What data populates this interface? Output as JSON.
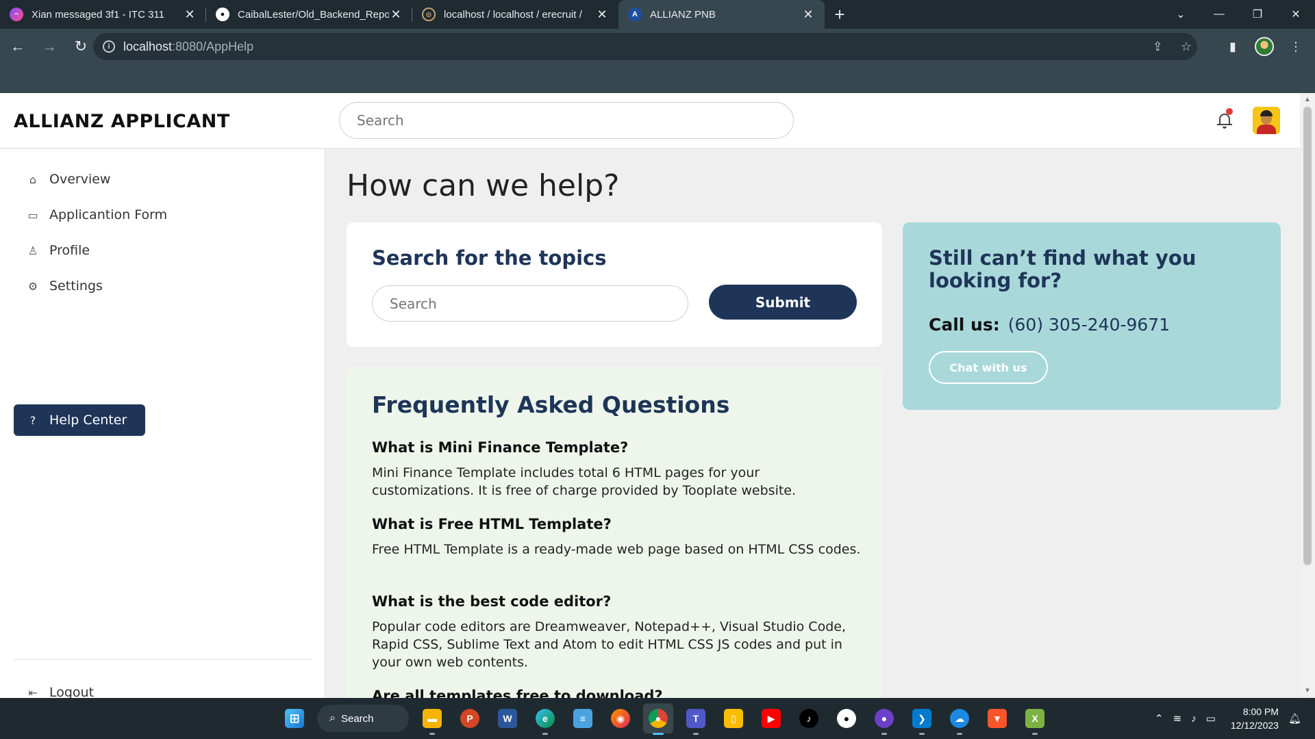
{
  "browser": {
    "tabs": [
      {
        "title": "Xian messaged 3f1 - ITC 311",
        "icon": "messenger-icon",
        "active": false
      },
      {
        "title": "CaibalLester/Old_Backend_Repo",
        "icon": "github-icon",
        "active": false
      },
      {
        "title": "localhost / localhost / erecruit /",
        "icon": "phpmyadmin-icon",
        "active": false
      },
      {
        "title": "ALLIANZ PNB",
        "icon": "allianz-icon",
        "active": true
      }
    ],
    "url_host": "localhost",
    "url_path": ":8080/AppHelp"
  },
  "app": {
    "brand": "ALLIANZ APPLICANT",
    "search_placeholder": "Search"
  },
  "sidebar": {
    "items": [
      {
        "label": "Overview",
        "icon": "home-icon",
        "active": false
      },
      {
        "label": "Applicantion Form",
        "icon": "book-icon",
        "active": false
      },
      {
        "label": "Profile",
        "icon": "person-icon",
        "active": false
      },
      {
        "label": "Settings",
        "icon": "gear-icon",
        "active": false
      },
      {
        "label": "Help Center",
        "icon": "help-circle-icon",
        "active": true
      }
    ],
    "logout_label": "Logout"
  },
  "main": {
    "title": "How can we help?",
    "search_card": {
      "heading": "Search for the topics",
      "placeholder": "Search",
      "submit_label": "Submit"
    },
    "help_card": {
      "heading": "Still can’t find what you looking for?",
      "call_label": "Call us:",
      "phone": "(60) 305-240-9671",
      "chat_label": "Chat with us"
    },
    "faq": {
      "heading": "Frequently Asked Questions",
      "items": [
        {
          "q": "What is Mini Finance Template?",
          "a": "Mini Finance Template includes total 6 HTML pages for your customizations. It is free of charge provided by Tooplate website."
        },
        {
          "q": "What is Free HTML Template?",
          "a": "Free HTML Template is a ready-made web page based on HTML CSS codes."
        },
        {
          "q": "What is the best code editor?",
          "a": "Popular code editors are Dreamweaver, Notepad++, Visual Studio Code, Rapid CSS, Sublime Text and Atom to edit HTML CSS JS codes and put in your own web contents."
        },
        {
          "q": "Are all templates free to download?",
          "a": ""
        }
      ]
    }
  },
  "taskbar": {
    "search_label": "Search",
    "time": "8:00 PM",
    "date": "12/12/2023"
  },
  "colors": {
    "primary": "#1e3558",
    "help_card_bg": "#a9d8da",
    "faq_bg": "#eef6ec"
  }
}
